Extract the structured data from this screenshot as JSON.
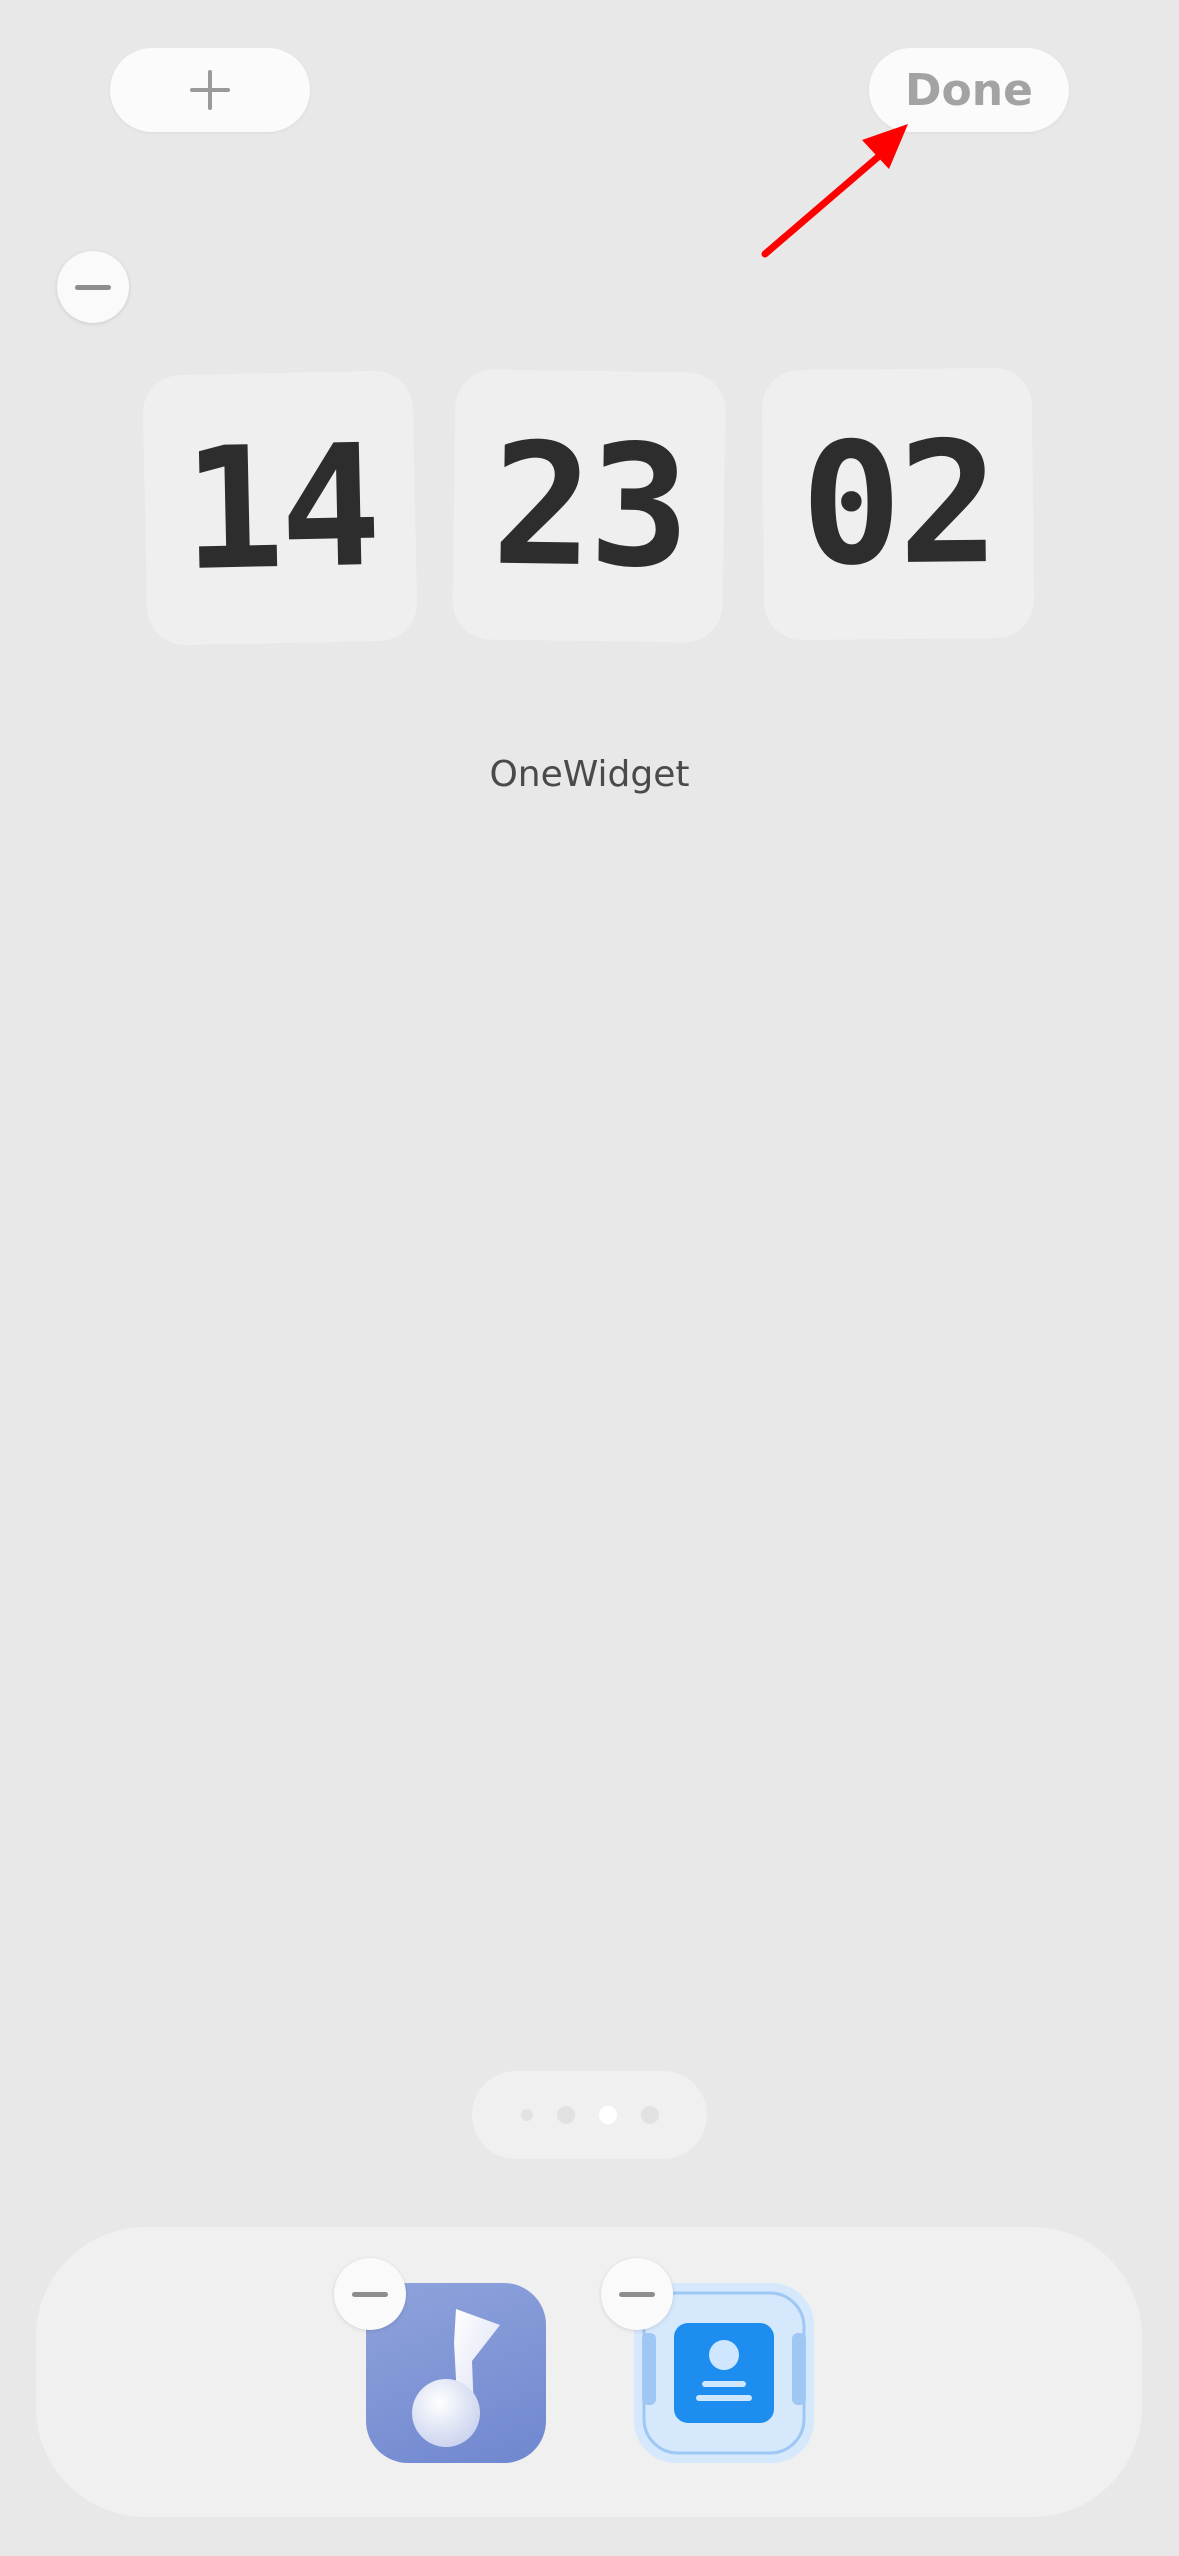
{
  "toolbar": {
    "add_icon": "plus-icon",
    "done_label": "Done"
  },
  "widget": {
    "remove_icon": "minus-icon",
    "hours": "14",
    "minutes": "23",
    "seconds": "02",
    "name": "OneWidget"
  },
  "page_indicator": {
    "pages": 4,
    "current": 3
  },
  "dock": {
    "apps": [
      {
        "icon": "music-note-icon"
      },
      {
        "icon": "contact-card-icon"
      }
    ]
  },
  "annotation": {
    "type": "arrow",
    "color": "#ff0000",
    "target": "Done"
  }
}
